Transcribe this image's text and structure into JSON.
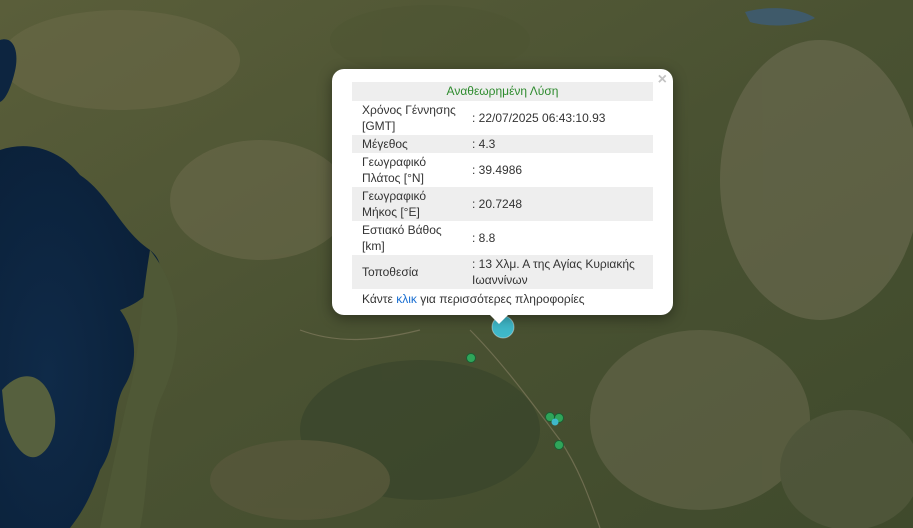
{
  "popup": {
    "title": "Αναθεωρημένη Λύση",
    "close_symbol": "×",
    "rows": [
      {
        "label": "Χρόνος Γέννησης [GMT]",
        "value": ": 22/07/2025 06:43:10.93"
      },
      {
        "label": "Μέγεθος",
        "value": ": 4.3"
      },
      {
        "label": "Γεωγραφικό Πλάτος [°N]",
        "value": ": 39.4986"
      },
      {
        "label": "Γεωγραφικό Μήκος [°E]",
        "value": ": 20.7248"
      },
      {
        "label": "Εστιακό Βάθος [km]",
        "value": ": 8.8"
      },
      {
        "label": "Τοποθεσία",
        "value": ": 13 Χλμ. Α της Αγίας Κυριακής Ιωαννίνων"
      }
    ],
    "more_prefix": "Κάντε",
    "more_link": "κλικ",
    "more_suffix": "για περισσότερες πληροφορίες"
  },
  "colors": {
    "title_green": "#2e8b2e",
    "link_blue": "#1a6fd1",
    "main_marker": "#3fb8c9",
    "small_marker": "#2fa55a"
  }
}
